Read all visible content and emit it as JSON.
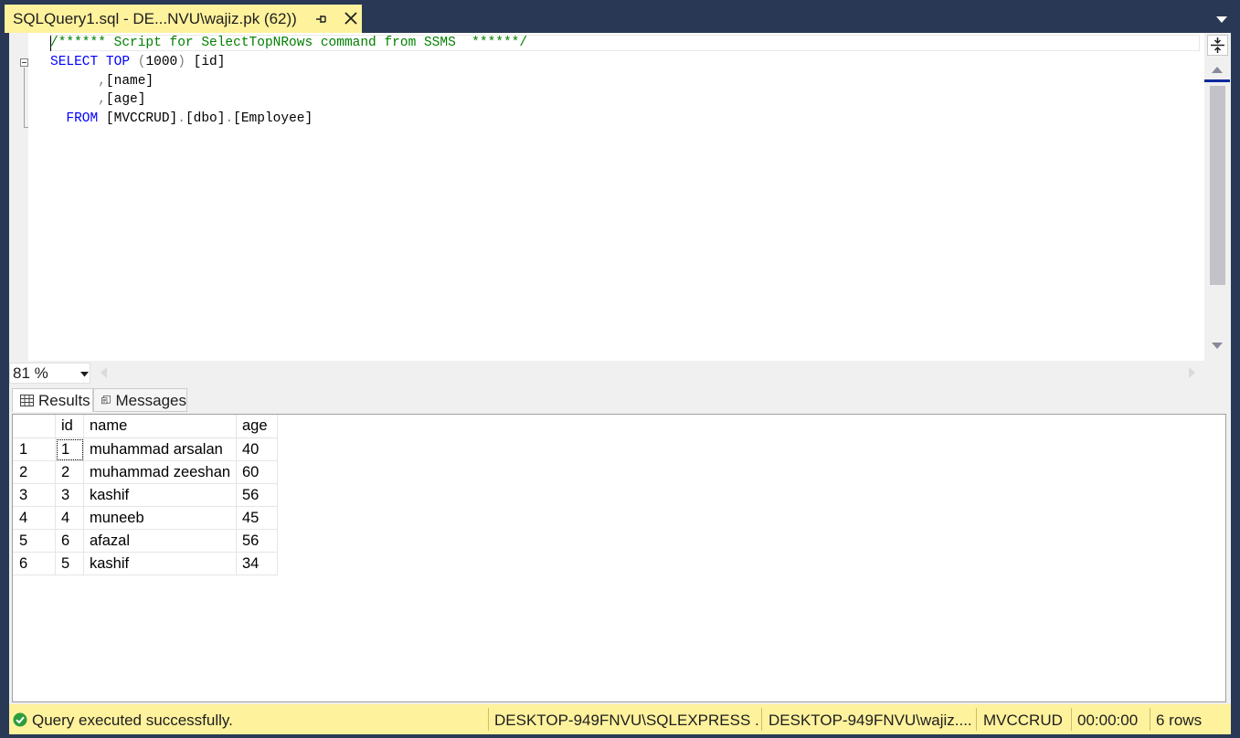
{
  "document_tab": {
    "title": "SQLQuery1.sql - DE...NVU\\wajiz.pk (62))"
  },
  "editor": {
    "lines": [
      {
        "tokens": [
          {
            "text": "/****** Script for SelectTopNRows command from SSMS  ******/",
            "color": "green"
          }
        ]
      },
      {
        "tokens": [
          {
            "text": "SELECT",
            "color": "blue"
          },
          {
            "text": " ",
            "color": "black"
          },
          {
            "text": "TOP",
            "color": "blue"
          },
          {
            "text": " (",
            "color": "gray"
          },
          {
            "text": "1000",
            "color": "black"
          },
          {
            "text": ") ",
            "color": "gray"
          },
          {
            "text": "[id]",
            "color": "black"
          }
        ]
      },
      {
        "tokens": [
          {
            "text": "      ",
            "color": "black"
          },
          {
            "text": ",",
            "color": "gray"
          },
          {
            "text": "[name]",
            "color": "black"
          }
        ]
      },
      {
        "tokens": [
          {
            "text": "      ",
            "color": "black"
          },
          {
            "text": ",",
            "color": "gray"
          },
          {
            "text": "[age]",
            "color": "black"
          }
        ]
      },
      {
        "tokens": [
          {
            "text": "  ",
            "color": "black"
          },
          {
            "text": "FROM",
            "color": "blue"
          },
          {
            "text": " [MVCCRUD]",
            "color": "black"
          },
          {
            "text": ".",
            "color": "gray"
          },
          {
            "text": "[dbo]",
            "color": "black"
          },
          {
            "text": ".",
            "color": "gray"
          },
          {
            "text": "[Employee]",
            "color": "black"
          }
        ]
      }
    ],
    "zoom": "81 %"
  },
  "results": {
    "tabs": [
      {
        "label": "Results",
        "icon": "grid-icon",
        "active": true
      },
      {
        "label": "Messages",
        "icon": "messages-icon",
        "active": false
      }
    ],
    "columns": [
      "id",
      "name",
      "age"
    ],
    "rows": [
      {
        "num": "1",
        "id": "1",
        "name": "muhammad arsalan",
        "age": "40"
      },
      {
        "num": "2",
        "id": "2",
        "name": "muhammad zeeshan",
        "age": "60"
      },
      {
        "num": "3",
        "id": "3",
        "name": "kashif",
        "age": "56"
      },
      {
        "num": "4",
        "id": "4",
        "name": "muneeb",
        "age": "45"
      },
      {
        "num": "5",
        "id": "6",
        "name": "afazal",
        "age": "56"
      },
      {
        "num": "6",
        "id": "5",
        "name": "kashif",
        "age": "34"
      }
    ]
  },
  "status_bar": {
    "message": "Query executed successfully.",
    "server": "DESKTOP-949FNVU\\SQLEXPRESS ...",
    "login": "DESKTOP-949FNVU\\wajiz....",
    "database": "MVCCRUD",
    "elapsed": "00:00:00",
    "row_count": "6 rows"
  },
  "colors": {
    "tab_active": "#fff29d",
    "chrome": "#293955",
    "sql_comment": "#008000",
    "sql_keyword": "#0000ff",
    "sql_operator": "#808080",
    "status_ok": "#2e9d3c"
  }
}
